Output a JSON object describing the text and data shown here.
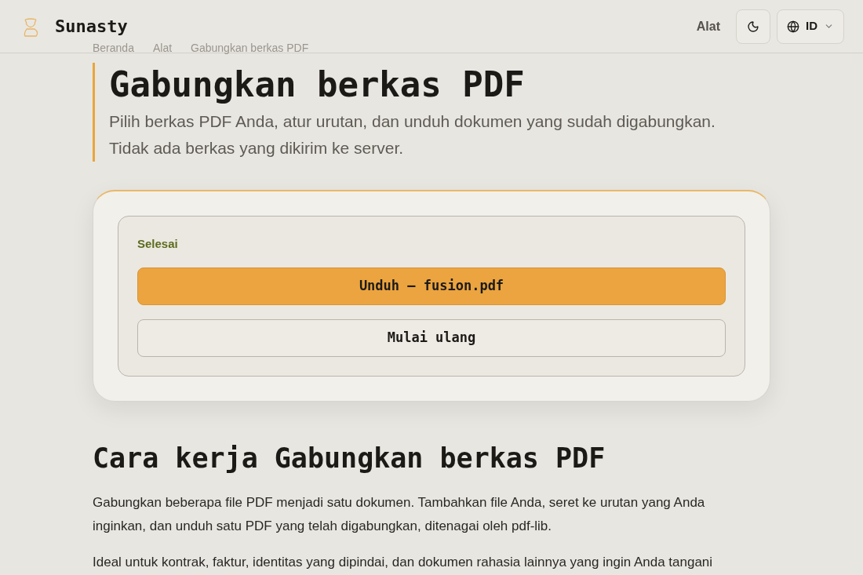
{
  "header": {
    "brand": "Sunasty",
    "nav_link": "Alat",
    "language": "ID"
  },
  "breadcrumb": [
    "Beranda",
    "Alat",
    "Gabungkan berkas PDF"
  ],
  "title": "Gabungkan berkas PDF",
  "subtitle": "Pilih berkas PDF Anda, atur urutan, dan unduh dokumen yang sudah digabungkan. Tidak ada berkas yang dikirim ke server.",
  "result": {
    "status": "Selesai",
    "download_button": "Unduh — fusion.pdf",
    "restart_button": "Mulai ulang"
  },
  "how_it_works": {
    "heading": "Cara kerja Gabungkan berkas PDF",
    "paragraphs": [
      "Gabungkan beberapa file PDF menjadi satu dokumen. Tambahkan file Anda, seret ke urutan yang Anda inginkan, dan unduh satu PDF yang telah digabungkan, ditenagai oleh pdf-lib.",
      "Ideal untuk kontrak, faktur, identitas yang dipindai, dan dokumen rahasia lainnya yang ingin Anda tangani"
    ]
  }
}
